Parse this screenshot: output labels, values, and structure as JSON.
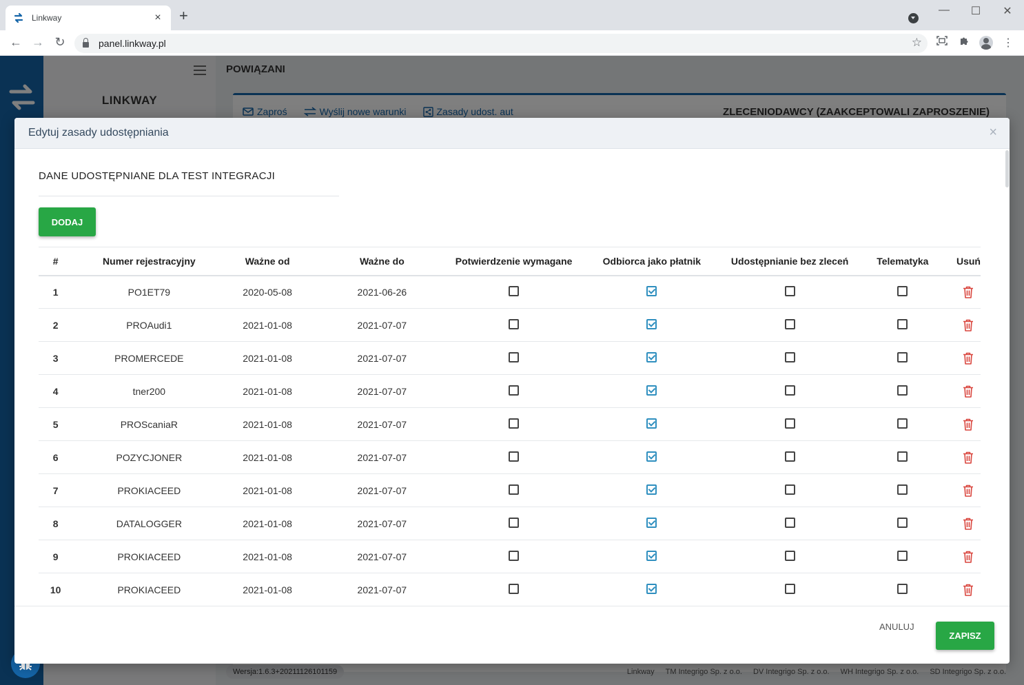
{
  "browser": {
    "tab_title": "Linkway",
    "tab_close": "×",
    "new_tab": "+",
    "url": "panel.linkway.pl",
    "minimize": "—",
    "maximize": "☐",
    "close": "✕"
  },
  "app": {
    "brand": "LINKWAY",
    "page_title": "POWIĄZANI",
    "toolbar": {
      "invite": "Zaproś",
      "send_terms": "Wyślij nowe warunki",
      "auto_rules": "Zasady udost. aut"
    },
    "panel_heading": "ZLECENIODAWCY (ZAAKCEPTOWALI ZAPROSZENIE)",
    "version": "Wersja:1.6.3+20211126101159",
    "footer": {
      "linkway": "Linkway",
      "tm": "TM Integrigo Sp. z o.o.",
      "dv": "DV Integrigo Sp. z o.o.",
      "wh": "WH Integrigo Sp. z o.o.",
      "sd": "SD Integrigo Sp. z o.o."
    }
  },
  "modal": {
    "title": "Edytuj zasady udostępniania",
    "close": "×",
    "section_title": "DANE UDOSTĘPNIANE DLA TEST INTEGRACJI",
    "add_label": "DODAJ",
    "cancel_label": "ANULUJ",
    "save_label": "ZAPISZ",
    "columns": [
      "#",
      "Numer rejestracyjny",
      "Ważne od",
      "Ważne do",
      "Potwierdzenie wymagane",
      "Odbiorca jako płatnik",
      "Udostępnianie bez zleceń",
      "Telematyka",
      "Usuń"
    ],
    "rows": [
      {
        "num": "1",
        "plate": "PO1ET79",
        "from": "2020-05-08",
        "to": "2021-06-26",
        "confirm": false,
        "payer": true,
        "no_orders": false,
        "telematics": false
      },
      {
        "num": "2",
        "plate": "PROAudi1",
        "from": "2021-01-08",
        "to": "2021-07-07",
        "confirm": false,
        "payer": true,
        "no_orders": false,
        "telematics": false
      },
      {
        "num": "3",
        "plate": "PROMERCEDE",
        "from": "2021-01-08",
        "to": "2021-07-07",
        "confirm": false,
        "payer": true,
        "no_orders": false,
        "telematics": false
      },
      {
        "num": "4",
        "plate": "tner200",
        "from": "2021-01-08",
        "to": "2021-07-07",
        "confirm": false,
        "payer": true,
        "no_orders": false,
        "telematics": false
      },
      {
        "num": "5",
        "plate": "PROScaniaR",
        "from": "2021-01-08",
        "to": "2021-07-07",
        "confirm": false,
        "payer": true,
        "no_orders": false,
        "telematics": false
      },
      {
        "num": "6",
        "plate": "POZYCJONER",
        "from": "2021-01-08",
        "to": "2021-07-07",
        "confirm": false,
        "payer": true,
        "no_orders": false,
        "telematics": false
      },
      {
        "num": "7",
        "plate": "PROKIACEED",
        "from": "2021-01-08",
        "to": "2021-07-07",
        "confirm": false,
        "payer": true,
        "no_orders": false,
        "telematics": false
      },
      {
        "num": "8",
        "plate": "DATALOGGER",
        "from": "2021-01-08",
        "to": "2021-07-07",
        "confirm": false,
        "payer": true,
        "no_orders": false,
        "telematics": false
      },
      {
        "num": "9",
        "plate": "PROKIACEED",
        "from": "2021-01-08",
        "to": "2021-07-07",
        "confirm": false,
        "payer": true,
        "no_orders": false,
        "telematics": false
      },
      {
        "num": "10",
        "plate": "PROKIACEED",
        "from": "2021-01-08",
        "to": "2021-07-07",
        "confirm": false,
        "payer": true,
        "no_orders": false,
        "telematics": false
      }
    ]
  },
  "colors": {
    "brand_blue": "#1565a8",
    "accent_green": "#28a745",
    "checkbox_checked": "#2f8fbf",
    "delete_red": "#d9453d"
  },
  "icons": {
    "delete": "trash-icon",
    "invite": "envelope-icon",
    "send_terms": "swap-arrows-icon",
    "auto_rules": "share-icon",
    "bug": "bug-icon"
  }
}
